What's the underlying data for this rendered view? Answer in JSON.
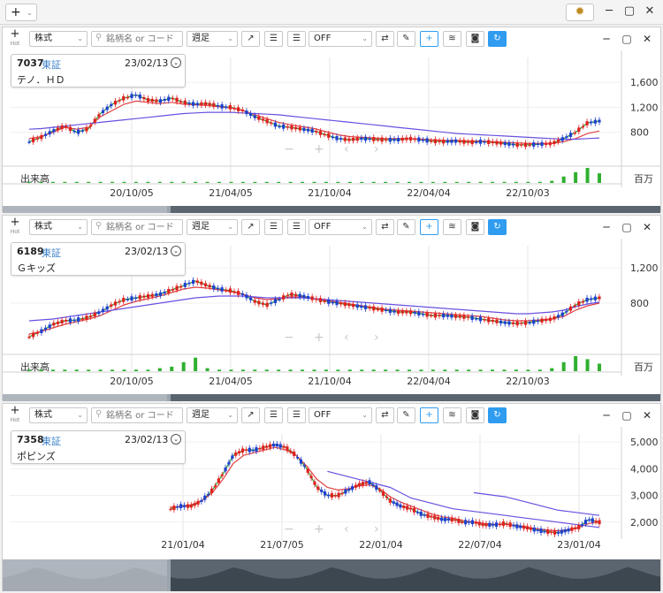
{
  "toolbar": {
    "add_label": "+",
    "add_caret": "⌄",
    "gear_icon": "gear-icon",
    "minimize": "─",
    "maximize": "▢",
    "close": "✕"
  },
  "panel_common": {
    "hot_label": "Hot",
    "type_select": "株式",
    "search_placeholder": "銘柄名 or コード",
    "period_select": "週足",
    "indicator_select": "OFF",
    "volume_label": "出来高",
    "volume_unit": "百万",
    "nav_minus": "−",
    "nav_plus": "+",
    "nav_prev": "‹",
    "nav_next": "›"
  },
  "colors": {
    "accent": "#2f9cf0",
    "up": "#e02020",
    "down": "#1f3fd0",
    "ma_short": "#2aa02a",
    "ma_mid": "#e04040",
    "ma_long": "#6a50e0",
    "volume": "#30b030"
  },
  "panels": [
    {
      "code": "7037",
      "market": "東証",
      "date": "23/02/13",
      "name": "テノ．ＨＤ"
    },
    {
      "code": "6189",
      "market": "東証",
      "date": "23/02/13",
      "name": "Ｇキッズ"
    },
    {
      "code": "7358",
      "market": "東証",
      "date": "23/02/13",
      "name": "ポピンズ"
    }
  ],
  "chart_data": [
    {
      "type": "line",
      "x_tick_labels": [
        "20/10/05",
        "21/04/05",
        "21/10/04",
        "22/04/04",
        "22/10/03"
      ],
      "y_tick_labels": [
        "1,600",
        "1,200",
        "800"
      ],
      "ylim": [
        300,
        2000
      ],
      "series": [
        {
          "values": [
            650,
            720,
            820,
            900,
            800,
            860,
            1100,
            1250,
            1350,
            1400,
            1320,
            1300,
            1350,
            1280,
            1250,
            1260,
            1220,
            1200,
            1150,
            1050,
            980,
            900,
            880,
            850,
            820,
            760,
            700,
            680,
            700,
            690,
            680,
            680,
            700,
            680,
            660,
            650,
            660,
            640,
            650,
            640,
            620,
            600,
            600,
            610,
            620,
            700,
            800,
            950,
            980
          ]
        },
        {
          "values": [
            700,
            730,
            800,
            880,
            850,
            880,
            1050,
            1150,
            1250,
            1300,
            1280,
            1260,
            1280,
            1250,
            1240,
            1230,
            1210,
            1190,
            1150,
            1080,
            1020,
            960,
            920,
            890,
            860,
            810,
            760,
            730,
            720,
            710,
            700,
            700,
            700,
            690,
            680,
            670,
            670,
            660,
            660,
            650,
            640,
            630,
            620,
            620,
            620,
            650,
            700,
            780,
            820
          ]
        },
        {
          "values": [
            850,
            860,
            880,
            900,
            920,
            940,
            960,
            980,
            1000,
            1020,
            1040,
            1060,
            1080,
            1100,
            1110,
            1120,
            1120,
            1120,
            1110,
            1100,
            1090,
            1080,
            1060,
            1040,
            1020,
            1000,
            980,
            960,
            940,
            920,
            900,
            880,
            860,
            840,
            820,
            800,
            780,
            770,
            760,
            750,
            740,
            730,
            720,
            710,
            700,
            690,
            690,
            700,
            710
          ]
        }
      ],
      "volume": [
        1,
        1,
        1,
        1,
        1,
        1,
        1,
        1,
        1,
        1,
        1,
        1,
        1,
        1,
        1,
        1,
        1,
        1,
        1,
        1,
        1,
        1,
        1,
        1,
        1,
        1,
        1,
        1,
        1,
        1,
        1,
        1,
        1,
        1,
        1,
        1,
        1,
        1,
        1,
        1,
        1,
        1,
        1,
        1,
        2,
        6,
        10,
        14,
        9
      ]
    },
    {
      "type": "line",
      "x_tick_labels": [
        "20/10/05",
        "21/04/05",
        "21/10/04",
        "22/04/04",
        "22/10/03"
      ],
      "y_tick_labels": [
        "1,200",
        "800"
      ],
      "ylim": [
        250,
        1450
      ],
      "series": [
        {
          "values": [
            420,
            480,
            560,
            600,
            610,
            640,
            700,
            780,
            840,
            860,
            880,
            900,
            950,
            1000,
            1050,
            1000,
            960,
            940,
            900,
            820,
            780,
            840,
            900,
            880,
            850,
            820,
            800,
            780,
            760,
            740,
            720,
            700,
            700,
            680,
            660,
            660,
            650,
            640,
            620,
            600,
            580,
            570,
            580,
            600,
            620,
            680,
            780,
            840,
            860
          ]
        },
        {
          "values": [
            450,
            480,
            520,
            560,
            590,
            620,
            660,
            720,
            780,
            820,
            850,
            880,
            920,
            960,
            980,
            970,
            950,
            930,
            900,
            860,
            840,
            850,
            870,
            870,
            850,
            830,
            810,
            790,
            770,
            750,
            730,
            720,
            710,
            700,
            690,
            680,
            670,
            660,
            650,
            630,
            610,
            600,
            600,
            610,
            620,
            650,
            720,
            770,
            800
          ]
        },
        {
          "values": [
            600,
            610,
            620,
            640,
            660,
            680,
            700,
            720,
            740,
            760,
            780,
            800,
            820,
            840,
            860,
            870,
            880,
            880,
            880,
            870,
            860,
            860,
            860,
            860,
            850,
            840,
            830,
            820,
            810,
            800,
            790,
            780,
            770,
            760,
            750,
            740,
            730,
            720,
            710,
            700,
            690,
            680,
            680,
            690,
            700,
            720,
            760,
            790,
            810
          ]
        }
      ],
      "volume": [
        1,
        1,
        1,
        1,
        1,
        1,
        1,
        1,
        1,
        1,
        1,
        2,
        3,
        6,
        9,
        2,
        1,
        1,
        1,
        1,
        1,
        1,
        1,
        1,
        1,
        1,
        1,
        1,
        1,
        1,
        1,
        1,
        1,
        1,
        1,
        1,
        1,
        1,
        1,
        1,
        1,
        1,
        1,
        1,
        2,
        6,
        10,
        8,
        5
      ]
    },
    {
      "type": "line",
      "x_tick_labels": [
        "21/01/04",
        "21/07/05",
        "22/01/04",
        "22/07/04",
        "23/01/04"
      ],
      "y_tick_labels": [
        "5,000",
        "4,000",
        "3,000",
        "2,000"
      ],
      "ylim": [
        1200,
        5300
      ],
      "series": [
        {
          "values": [
            2500,
            2600,
            2600,
            2800,
            3200,
            3800,
            4500,
            4700,
            4700,
            4800,
            4900,
            4800,
            4500,
            4000,
            3300,
            3000,
            3000,
            3200,
            3400,
            3500,
            3200,
            2800,
            2600,
            2500,
            2300,
            2200,
            2100,
            2100,
            2000,
            2000,
            1900,
            1900,
            1950,
            1850,
            1800,
            1700,
            1650,
            1600,
            1700,
            1800,
            2100,
            2000
          ]
        },
        {
          "values": [
            2550,
            2600,
            2650,
            2800,
            3100,
            3600,
            4200,
            4500,
            4600,
            4700,
            4800,
            4700,
            4500,
            4100,
            3600,
            3300,
            3200,
            3250,
            3350,
            3400,
            3250,
            2950,
            2750,
            2600,
            2450,
            2300,
            2200,
            2150,
            2050,
            2000,
            1950,
            1920,
            1920,
            1880,
            1820,
            1750,
            1700,
            1680,
            1720,
            1800,
            1950,
            2000
          ]
        },
        {
          "values": [
            3900,
            3800,
            3700,
            3600,
            3500,
            3400,
            3300,
            3100,
            2900,
            2800,
            2700,
            2600,
            2500,
            2450,
            2400,
            2350,
            2300,
            2250,
            2200,
            2150,
            2100,
            2050,
            2000,
            1950,
            1900,
            1850,
            1800
          ]
        },
        {
          "values": [
            3100,
            3050,
            3000,
            2950,
            2850,
            2750,
            2650,
            2550,
            2450,
            2400,
            2350,
            2300,
            2250
          ]
        }
      ],
      "volume": []
    }
  ]
}
